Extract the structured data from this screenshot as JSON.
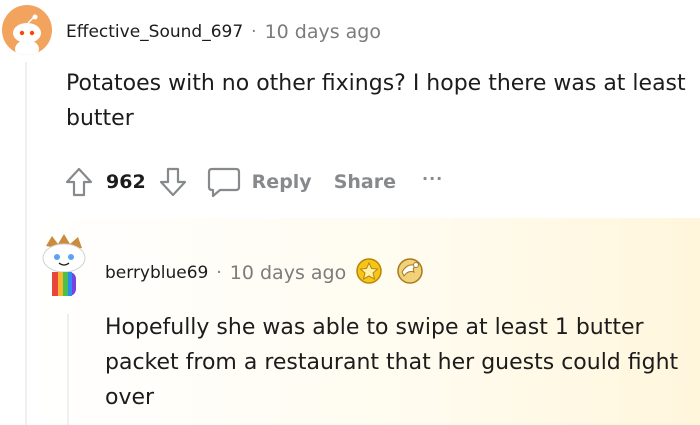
{
  "comment": {
    "author": "Effective_Sound_697",
    "time": "10 days ago",
    "separator": "·",
    "text": "Potatoes with no other fixings? I hope there was at least butter",
    "votes": "962",
    "reply_label": "Reply",
    "share_label": "Share",
    "more_label": "···"
  },
  "reply": {
    "author": "berryblue69",
    "time": "10 days ago",
    "separator": "·",
    "text": "Hopefully she was able to swipe at least 1 butter packet from a restaurant that her guests could fight over",
    "awards": [
      "gold-award-icon",
      "bronze-award-icon"
    ]
  },
  "colors": {
    "meta": "#7c7c7c",
    "action": "#878a8c",
    "avatar1": "#f2a35e",
    "highlight": "#fff6dc"
  }
}
